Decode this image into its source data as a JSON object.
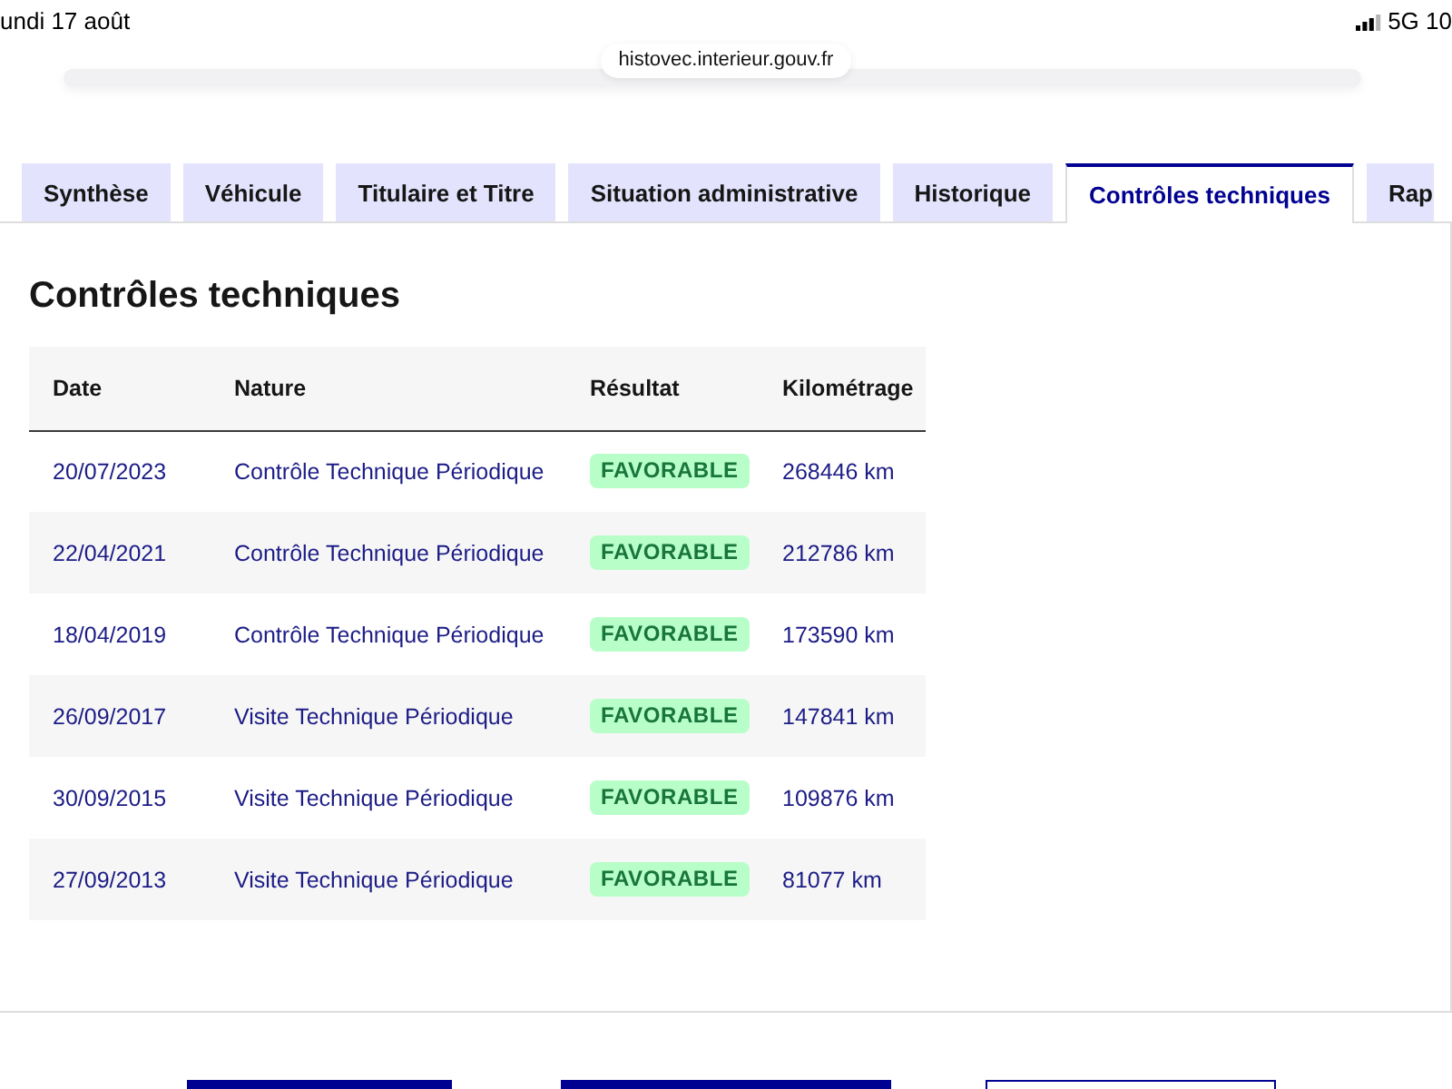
{
  "status_bar": {
    "date": "undi 17 août",
    "network": "5G 10"
  },
  "address_bar": {
    "url": "histovec.interieur.gouv.fr"
  },
  "tabs": [
    {
      "label": "Synthèse",
      "selected": false
    },
    {
      "label": "Véhicule",
      "selected": false
    },
    {
      "label": "Titulaire et Titre",
      "selected": false
    },
    {
      "label": "Situation administrative",
      "selected": false
    },
    {
      "label": "Historique",
      "selected": false
    },
    {
      "label": "Contrôles techniques",
      "selected": true
    },
    {
      "label": "Rap",
      "selected": false
    }
  ],
  "panel": {
    "title": "Contrôles techniques",
    "table": {
      "columns": [
        "Date",
        "Nature",
        "Résultat",
        "Kilométrage"
      ],
      "rows": [
        {
          "date": "20/07/2023",
          "nature": "Contrôle Technique Périodique",
          "result": {
            "label": "FAVORABLE",
            "kind": "success"
          },
          "mileage": "268446 km"
        },
        {
          "date": "22/04/2021",
          "nature": "Contrôle Technique Périodique",
          "result": {
            "label": "FAVORABLE",
            "kind": "success"
          },
          "mileage": "212786 km"
        },
        {
          "date": "18/04/2019",
          "nature": "Contrôle Technique Périodique",
          "result": {
            "label": "FAVORABLE",
            "kind": "success"
          },
          "mileage": "173590 km"
        },
        {
          "date": "26/09/2017",
          "nature": "Visite Technique Périodique",
          "result": {
            "label": "FAVORABLE",
            "kind": "success"
          },
          "mileage": "147841 km"
        },
        {
          "date": "30/09/2015",
          "nature": "Visite Technique Périodique",
          "result": {
            "label": "FAVORABLE",
            "kind": "success"
          },
          "mileage": "109876 km"
        },
        {
          "date": "27/09/2013",
          "nature": "Visite Technique Périodique",
          "result": {
            "label": "FAVORABLE",
            "kind": "success"
          },
          "mileage": "81077 km"
        }
      ]
    }
  },
  "footer_buttons": [
    {
      "kind": "primary"
    },
    {
      "kind": "primary"
    },
    {
      "kind": "secondary"
    }
  ]
}
